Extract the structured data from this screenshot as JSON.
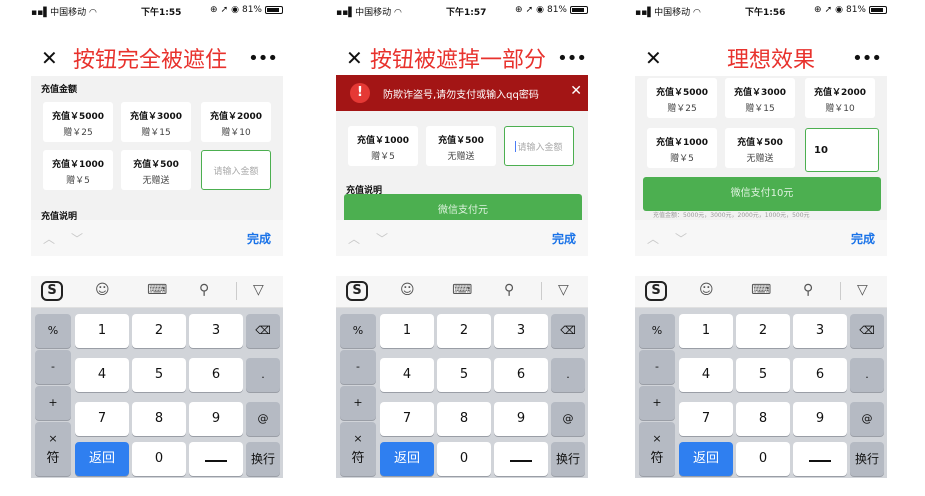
{
  "status_bar": {
    "carrier": "中国移动",
    "battery": "81%"
  },
  "keyboard": {
    "done_label": "完成",
    "left_keys": [
      "%",
      "-",
      "+",
      "×"
    ],
    "digits": [
      "1",
      "2",
      "3",
      "4",
      "5",
      "6",
      "7",
      "8",
      "9",
      "0"
    ],
    "right_keys": [
      "⌫",
      ".",
      "@"
    ],
    "bottom_left": "符",
    "back_label": "返回",
    "newline_label": "换行"
  },
  "phones": [
    {
      "time": "下午1:55",
      "title": "按钮完全被遮住",
      "section_amount": "充值金额",
      "section_desc": "充值说明",
      "cards": [
        {
          "amount": "充值￥5000",
          "gift": "赠￥25"
        },
        {
          "amount": "充值￥3000",
          "gift": "赠￥15"
        },
        {
          "amount": "充值￥2000",
          "gift": "赠￥10"
        },
        {
          "amount": "充值￥1000",
          "gift": "赠￥5"
        },
        {
          "amount": "充值￥500",
          "gift": "无赠送"
        }
      ],
      "input_placeholder": "请输入金额"
    },
    {
      "time": "下午1:57",
      "title": "按钮被遮掉一部分",
      "warning": "防欺诈盗号,请勿支付或输入qq密码",
      "warning_close": "✕",
      "section_desc": "充值说明",
      "cards": [
        {
          "amount": "充值￥1000",
          "gift": "赠￥5"
        },
        {
          "amount": "充值￥500",
          "gift": "无赠送"
        }
      ],
      "input_placeholder": "请输入金额",
      "pay_label": "微信支付元"
    },
    {
      "time": "下午1:56",
      "title": "理想效果",
      "cards": [
        {
          "amount": "充值￥5000",
          "gift": "赠￥25"
        },
        {
          "amount": "充值￥3000",
          "gift": "赠￥15"
        },
        {
          "amount": "充值￥2000",
          "gift": "赠￥10"
        },
        {
          "amount": "充值￥1000",
          "gift": "赠￥5"
        },
        {
          "amount": "充值￥500",
          "gift": "无赠送"
        }
      ],
      "input_value": "10",
      "pay_label": "微信支付10元",
      "hint": "充值金额：5000元，3000元，2000元，1000元，500元"
    }
  ]
}
